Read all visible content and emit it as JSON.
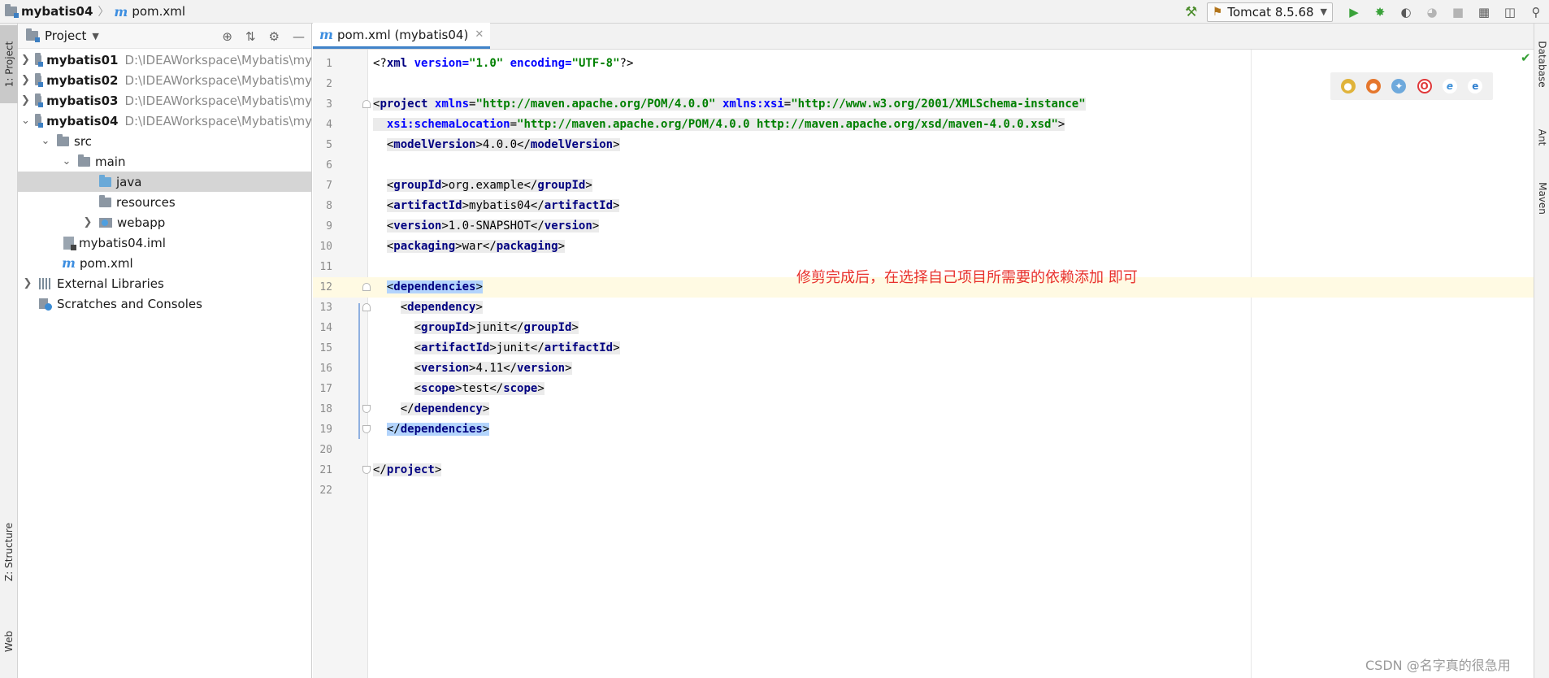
{
  "nav": {
    "project": "mybatis04",
    "file": "pom.xml"
  },
  "toolbar": {
    "run_config": "Tomcat 8.5.68"
  },
  "left_stripe": {
    "project_tab": "1: Project",
    "structure_tab": "Z: Structure",
    "web_tab": "Web"
  },
  "project_panel": {
    "title": "Project",
    "tree": [
      {
        "name": "mybatis01",
        "path": "D:\\IDEAWorkspace\\Mybatis\\my"
      },
      {
        "name": "mybatis02",
        "path": "D:\\IDEAWorkspace\\Mybatis\\my"
      },
      {
        "name": "mybatis03",
        "path": "D:\\IDEAWorkspace\\Mybatis\\my"
      },
      {
        "name": "mybatis04",
        "path": "D:\\IDEAWorkspace\\Mybatis\\my"
      },
      {
        "name": "src"
      },
      {
        "name": "main"
      },
      {
        "name": "java"
      },
      {
        "name": "resources"
      },
      {
        "name": "webapp"
      },
      {
        "name": "mybatis04.iml"
      },
      {
        "name": "pom.xml"
      },
      {
        "name": "External Libraries"
      },
      {
        "name": "Scratches and Consoles"
      }
    ]
  },
  "editor": {
    "tab_label": "pom.xml (mybatis04)",
    "line_numbers": [
      "1",
      "2",
      "3",
      "4",
      "5",
      "6",
      "7",
      "8",
      "9",
      "10",
      "11",
      "12",
      "13",
      "14",
      "15",
      "16",
      "17",
      "18",
      "19",
      "20",
      "21",
      "22"
    ],
    "code": {
      "xml_decl": [
        "<?",
        "xml",
        " ",
        "version",
        "=",
        "\"1.0\"",
        " ",
        "encoding",
        "=",
        "\"UTF-8\"",
        "?>"
      ],
      "l3_open": "<",
      "l3_tag": "project",
      "l3_attr1": "xmlns",
      "l3_val1": "\"http://maven.apache.org/POM/4.0.0\"",
      "l3_attr2": "xmlns:xsi",
      "l3_val2": "\"http://www.w3.org/2001/XMLSchema-instance\"",
      "l4_attr": "xsi:schemaLocation",
      "l4_val": "\"http://maven.apache.org/POM/4.0.0 http://maven.apache.org/xsd/maven-4.0.0.xsd\"",
      "l5_tag": "modelVersion",
      "l5_text": "4.0.0",
      "l7_tag": "groupId",
      "l7_text": "org.example",
      "l8_tag": "artifactId",
      "l8_text": "mybatis04",
      "l9_tag": "version",
      "l9_text": "1.0-SNAPSHOT",
      "l10_tag": "packaging",
      "l10_text": "war",
      "l12_tag": "dependencies",
      "l13_tag": "dependency",
      "l14_tag": "groupId",
      "l14_text": "junit",
      "l15_tag": "artifactId",
      "l15_text": "junit",
      "l16_tag": "version",
      "l16_text": "4.11",
      "l17_tag": "scope",
      "l17_text": "test",
      "l18_tag": "dependency",
      "l19_tag": "dependencies",
      "l21_tag": "project"
    }
  },
  "annotation": "修剪完成后，在选择自己项目所需要的依赖添加 即可",
  "right_stripe": {
    "database": "Database",
    "ant": "Ant",
    "maven": "Maven"
  },
  "watermark": "CSDN @名字真的很急用",
  "colors": {
    "annotation": "#e8312c",
    "selection": "#b3d4fc",
    "current_line": "#fffae3",
    "tag": "#000080",
    "attr_value": "#008000"
  }
}
